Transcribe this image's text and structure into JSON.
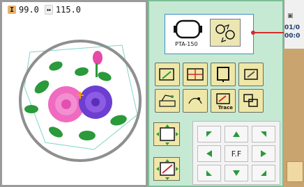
{
  "preview": {
    "height_value": "99.0",
    "width_value": "115.0",
    "height_icon": "height-icon",
    "width_icon": "width-icon"
  },
  "hoop": {
    "label": "PTA-150",
    "icon": "hoop-icon"
  },
  "buttons": {
    "trace_label": "Trace",
    "center_label": "F.F"
  },
  "sidebar": {
    "date_text": "01/0",
    "time_text": "00:0"
  },
  "colors": {
    "panel_bg": "#c6e9d4",
    "button_bg": "#efe7a8",
    "accent_red": "#d42b2b",
    "accent_blue": "#3f8cc8",
    "preview_border": "#9a9a9a"
  }
}
